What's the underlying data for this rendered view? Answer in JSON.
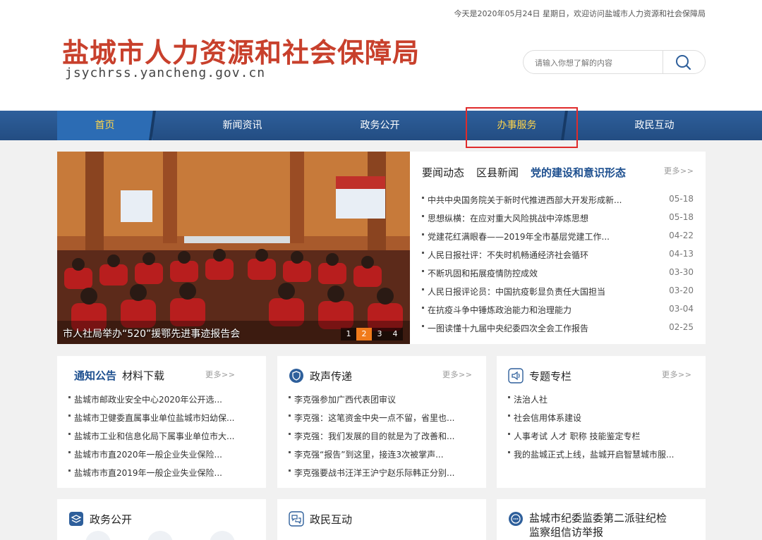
{
  "header": {
    "topline": "今天是2020年05月24日 星期日，欢迎访问盐城市人力资源和社会保障局",
    "title": "盐城市人力资源和社会保障局",
    "domain": "jsychrss.yancheng.gov.cn",
    "search_placeholder": "请输入你想了解的内容",
    "title_color": "#c8402c"
  },
  "nav": {
    "items": [
      "首页",
      "新闻资讯",
      "政务公开",
      "办事服务",
      "政民互动"
    ],
    "accent": "#2e5f9b",
    "highlight_color": "#e02b2b"
  },
  "slider": {
    "caption": "市人社局举办“520”援鄂先进事迹报告会",
    "pages": [
      "1",
      "2",
      "3",
      "4"
    ],
    "active_page": "2"
  },
  "news": {
    "tabs": [
      "要闻动态",
      "区县新闻",
      "党的建设和意识形态"
    ],
    "more": "更多>>",
    "items": [
      {
        "title": "中共中央国务院关于新时代推进西部大开发形成新...",
        "date": "05-18"
      },
      {
        "title": "思想纵横：在应对重大风险挑战中淬炼思想",
        "date": "05-18"
      },
      {
        "title": "党建花红满眼春——2019年全市基层党建工作...",
        "date": "04-22"
      },
      {
        "title": "人民日报社评：不失时机畅通经济社会循环",
        "date": "04-13"
      },
      {
        "title": "不断巩固和拓展疫情防控成效",
        "date": "03-30"
      },
      {
        "title": "人民日报评论员：中国抗疫彰显负责任大国担当",
        "date": "03-20"
      },
      {
        "title": "在抗疫斗争中锤炼政治能力和治理能力",
        "date": "03-04"
      },
      {
        "title": "一图读懂十九届中央纪委四次全会工作报告",
        "date": "02-25"
      }
    ]
  },
  "notice": {
    "tab1": "通知公告",
    "tab2": "材料下载",
    "more": "更多>>",
    "items": [
      "盐城市邮政业安全中心2020年公开选...",
      "盐城市卫健委直属事业单位盐城市妇幼保...",
      "盐城市工业和信息化局下属事业单位市大...",
      "盐城市市直2020年一般企业失业保险...",
      "盐城市市直2019年一般企业失业保险..."
    ]
  },
  "policy": {
    "title": "政声传递",
    "more": "更多>>",
    "items": [
      "李克强参加广西代表团审议",
      "李克强：这笔资金中央一点不留，省里也...",
      "李克强：我们发展的目的就是为了改善和...",
      "李克强“报告”到这里，接连3次被掌声...",
      "李克强要战书汪洋王沪宁赵乐际韩正分别..."
    ]
  },
  "special": {
    "title": "专题专栏",
    "more": "更多>>",
    "items": [
      "法治人社",
      "社会信用体系建设",
      "人事考试 人才 职称 技能鉴定专栏",
      "我的盐城正式上线，盐城开启智慧城市服..."
    ]
  },
  "bottom": {
    "box1": "政务公开",
    "box2": "政民互动",
    "box3_line1": "盐城市纪委监委第二派驻纪检",
    "box3_line2": "监察组信访举报"
  }
}
